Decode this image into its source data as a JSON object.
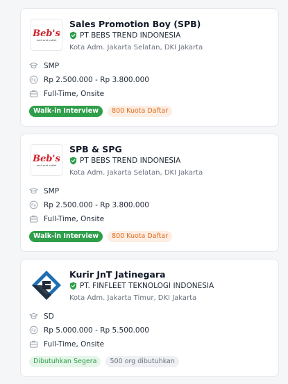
{
  "jobs": [
    {
      "title": "Sales Promotion Boy (SPB)",
      "company": "PT BEBS TREND INDONESIA",
      "location": "Kota Adm. Jakarta Selatan, DKI Jakarta",
      "logo_icon": "bebs-logo",
      "logo_text": "Beb's",
      "logo_subtext": "mall and outlet",
      "education": "SMP",
      "salary": "Rp 2.500.000 - Rp 3.800.000",
      "job_type": "Full-Time,  Onsite",
      "badges": [
        "Walk-in Interview",
        "800 Kuota Daftar"
      ]
    },
    {
      "title": "SPB & SPG",
      "company": "PT BEBS TREND INDONESIA",
      "location": "Kota Adm. Jakarta Selatan, DKI Jakarta",
      "logo_icon": "bebs-logo",
      "logo_text": "Beb's",
      "logo_subtext": "mall and outlet",
      "education": "SMP",
      "salary": "Rp 2.500.000 - Rp 3.800.000",
      "job_type": "Full-Time,  Onsite",
      "badges": [
        "Walk-in Interview",
        "800 Kuota Daftar"
      ]
    },
    {
      "title": "Kurir JnT Jatinegara",
      "company": "PT. FINFLEET TEKNOLOGI INDONESIA",
      "location": "Kota Adm. Jakarta Timur, DKI Jakarta",
      "logo_icon": "finfleet-logo",
      "education": "SD",
      "salary": "Rp 5.000.000 - Rp 5.500.000",
      "job_type": "Full-Time,  Onsite",
      "badges": [
        "Dibutuhkan Segera",
        "500 org dibutuhkan"
      ]
    }
  ],
  "colors": {
    "verified": "#2e9e4a",
    "walkin_badge": "#2e9e4a",
    "kuota_text": "#e26a1c",
    "bebs_red": "#d0202a",
    "finfleet_blue": "#1e6fb3"
  },
  "icons": {
    "education": "graduation-cap-icon",
    "salary": "money-icon",
    "job_type": "briefcase-icon",
    "verified": "verified-shield-icon"
  }
}
